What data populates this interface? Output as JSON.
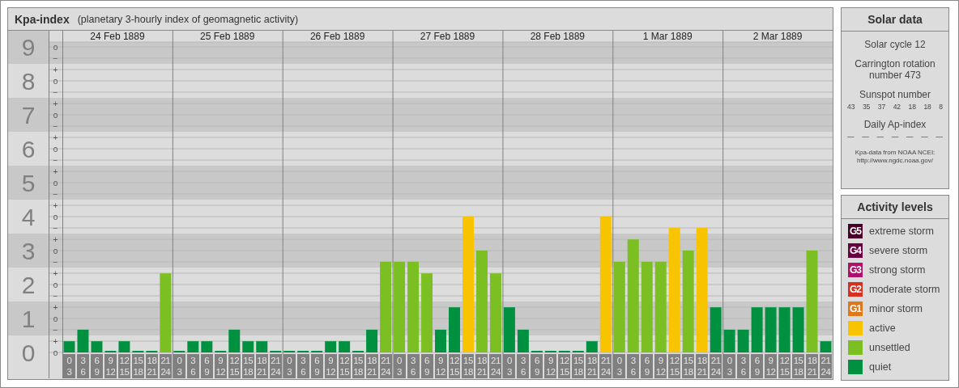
{
  "kpa_panel": {
    "title": "Kpa-index",
    "subtitle": "(planetary 3-hourly index of geomagnetic activity)",
    "days": [
      "24 Feb 1889",
      "25 Feb 1889",
      "26 Feb 1889",
      "27 Feb 1889",
      "28 Feb 1889",
      "1 Mar 1889",
      "2 Mar 1889"
    ],
    "chart_data": {
      "type": "bar",
      "stacked": true,
      "ylim": [
        0,
        9
      ],
      "categories": [
        "0 3",
        "3 6",
        "6 9",
        "9 12",
        "12 15",
        "15 18",
        "18 21",
        "21 24",
        "0 3",
        "3 6",
        "6 9",
        "9 12",
        "12 15",
        "15 18",
        "18 21",
        "21 24",
        "0 3",
        "3 6",
        "6 9",
        "9 12",
        "12 15",
        "15 18",
        "18 21",
        "21 24",
        "0 3",
        "3 6",
        "6 9",
        "9 12",
        "12 15",
        "15 18",
        "18 21",
        "21 24",
        "0 3",
        "3 6",
        "6 9",
        "9 12",
        "12 15",
        "15 18",
        "18 21",
        "21 24",
        "0 3",
        "3 6",
        "6 9",
        "9 12",
        "12 15",
        "15 18",
        "18 21",
        "21 24",
        "0 3",
        "3 6",
        "6 9",
        "9 12",
        "12 15",
        "15 18",
        "18 21",
        "21 24"
      ],
      "series": [
        {
          "name": "quiet",
          "color": "#009140",
          "values": [
            0.33,
            0.67,
            0.33,
            0,
            0.33,
            0,
            0,
            null,
            0,
            0.33,
            0.33,
            0,
            0.67,
            0.33,
            0.33,
            0,
            0,
            0,
            0,
            0.33,
            0.33,
            0,
            0.67,
            null,
            null,
            null,
            null,
            0.67,
            1.33,
            null,
            null,
            null,
            1.33,
            0.67,
            0,
            0,
            0,
            0,
            0.33,
            null,
            null,
            null,
            null,
            null,
            null,
            null,
            null,
            1.33,
            0.67,
            0.67,
            1.33,
            1.33,
            1.33,
            1.33,
            null,
            0.33
          ]
        },
        {
          "name": "unsettled",
          "color": "#7bbf22",
          "values": [
            null,
            null,
            null,
            null,
            null,
            null,
            null,
            2.33,
            null,
            null,
            null,
            null,
            null,
            null,
            null,
            null,
            null,
            null,
            null,
            null,
            null,
            null,
            null,
            2.67,
            2.67,
            2.67,
            2.33,
            null,
            null,
            null,
            3,
            2.33,
            null,
            null,
            null,
            null,
            null,
            null,
            null,
            null,
            2.67,
            3.33,
            2.67,
            2.67,
            null,
            3,
            null,
            null,
            null,
            null,
            null,
            null,
            null,
            null,
            3,
            null
          ]
        },
        {
          "name": "active",
          "color": "#f8c400",
          "values": [
            null,
            null,
            null,
            null,
            null,
            null,
            null,
            null,
            null,
            null,
            null,
            null,
            null,
            null,
            null,
            null,
            null,
            null,
            null,
            null,
            null,
            null,
            null,
            null,
            null,
            null,
            null,
            null,
            null,
            4,
            null,
            null,
            null,
            null,
            null,
            null,
            null,
            null,
            null,
            4,
            null,
            null,
            null,
            null,
            3.67,
            null,
            3.67,
            null,
            null,
            null,
            null,
            null,
            null,
            null,
            null,
            null
          ]
        }
      ],
      "yticks": [
        {
          "value": 0,
          "label": "0"
        },
        {
          "value": 1,
          "label": "1"
        },
        {
          "value": 2,
          "label": "2"
        },
        {
          "value": 3,
          "label": "3"
        },
        {
          "value": 4,
          "label": "4"
        },
        {
          "value": 5,
          "label": "5"
        },
        {
          "value": 6,
          "label": "6"
        },
        {
          "value": 7,
          "label": "7"
        },
        {
          "value": 8,
          "label": "8"
        },
        {
          "value": 9,
          "label": "9"
        }
      ],
      "grid": true
    },
    "sub_level_labels": [
      "o",
      "−",
      "+",
      "o",
      "−",
      "+",
      "o",
      "−",
      "+",
      "o",
      "−",
      "+",
      "o",
      "−",
      "+",
      "o",
      "−",
      "+",
      "o",
      "−",
      "+",
      "o",
      "−",
      "+",
      "o",
      "−",
      "+",
      "o"
    ]
  },
  "solar_data": {
    "title": "Solar data",
    "solar_cycle": "Solar cycle 12",
    "carrington_rotation": "Carrington rotation number 473",
    "sunspot_label": "Sunspot number",
    "sunspot_numbers": [
      "43",
      "35",
      "37",
      "42",
      "18",
      "18",
      "8"
    ],
    "ap_label": "Daily Ap-index",
    "ap_values": [
      "—",
      "—",
      "—",
      "—",
      "—",
      "—",
      "—"
    ],
    "source": "Kpa-data from NOAA NCEI: http://www.ngdc.noaa.gov/"
  },
  "activity_levels": {
    "title": "Activity levels",
    "items": [
      {
        "badge": "G5",
        "label": "extreme storm",
        "color": "#4a0026"
      },
      {
        "badge": "G4",
        "label": "severe storm",
        "color": "#6a0040"
      },
      {
        "badge": "G3",
        "label": "strong storm",
        "color": "#b0106a"
      },
      {
        "badge": "G2",
        "label": "moderate storm",
        "color": "#d83020"
      },
      {
        "badge": "G1",
        "label": "minor storm",
        "color": "#e07818"
      }
    ]
  }
}
